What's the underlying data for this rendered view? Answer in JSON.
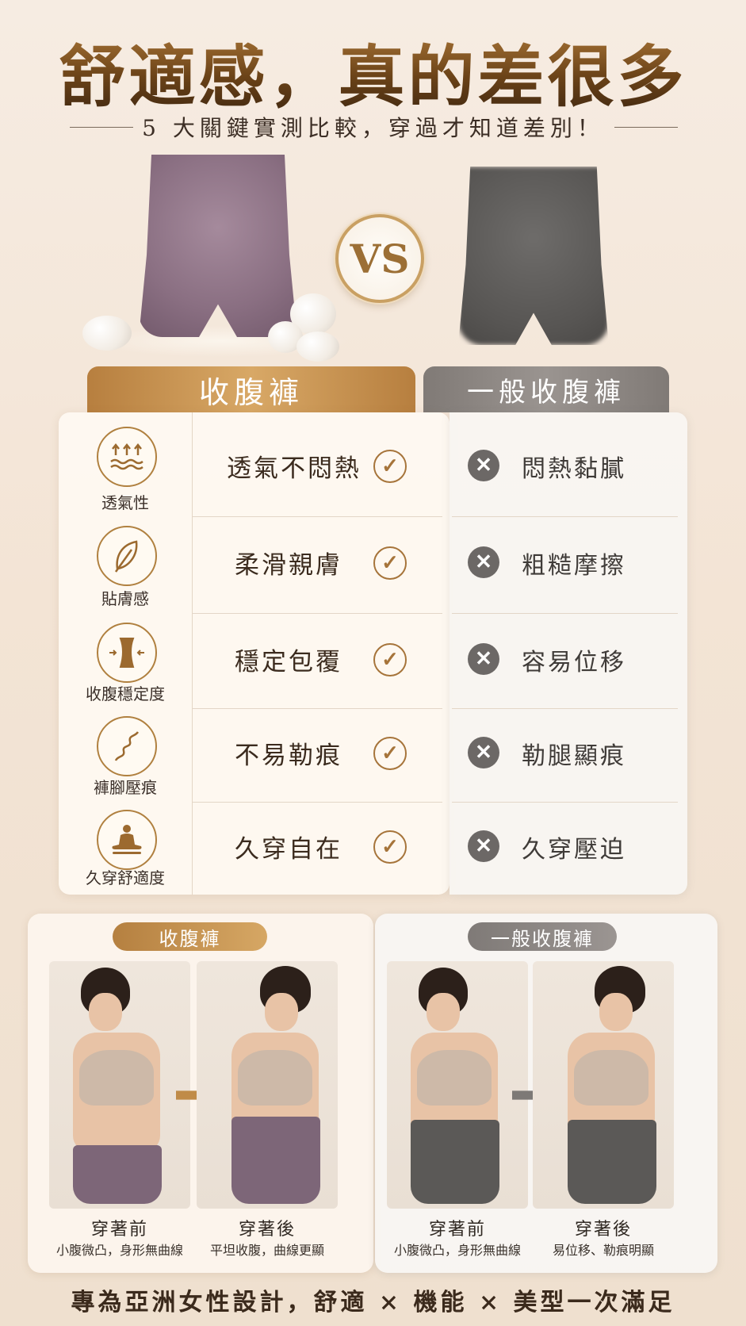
{
  "header": {
    "title": "舒適感，真的差很多",
    "subtitle": "5 大關鍵實測比較，穿過才知道差別！",
    "vs_label": "VS"
  },
  "table": {
    "left_header": "收腹褲",
    "right_header": "一般收腹褲",
    "rows": [
      {
        "icon": "air-flow-icon",
        "feature": "透氣性",
        "good": "透氣不悶熱",
        "bad": "悶熱黏膩"
      },
      {
        "icon": "feather-icon",
        "feature": "貼膚感",
        "good": "柔滑親膚",
        "bad": "粗糙摩擦"
      },
      {
        "icon": "waist-icon",
        "feature": "收腹穩定度",
        "good": "穩定包覆",
        "bad": "容易位移"
      },
      {
        "icon": "wave-line-icon",
        "feature": "褲腳壓痕",
        "good": "不易勒痕",
        "bad": "勒腿顯痕"
      },
      {
        "icon": "meditation-icon",
        "feature": "久穿舒適度",
        "good": "久穿自在",
        "bad": "久穿壓迫"
      }
    ],
    "check_glyph": "✓",
    "cross_glyph": "✕"
  },
  "compare": {
    "left_pill": "收腹褲",
    "right_pill": "一般收腹褲",
    "left": [
      {
        "label": "穿著前",
        "desc": "小腹微凸，身形無曲線"
      },
      {
        "label": "穿著後",
        "desc": "平坦收腹，曲線更顯"
      }
    ],
    "right": [
      {
        "label": "穿著前",
        "desc": "小腹微凸，身形無曲線"
      },
      {
        "label": "穿著後",
        "desc": "易位移、勒痕明顯"
      }
    ]
  },
  "footer": "專為亞洲女性設計，舒適 × 機能 × 美型一次滿足",
  "colors": {
    "gold": "#b77f3f",
    "gray": "#7f7a77",
    "purple": "#8a6f82",
    "dark_gray": "#575553"
  }
}
